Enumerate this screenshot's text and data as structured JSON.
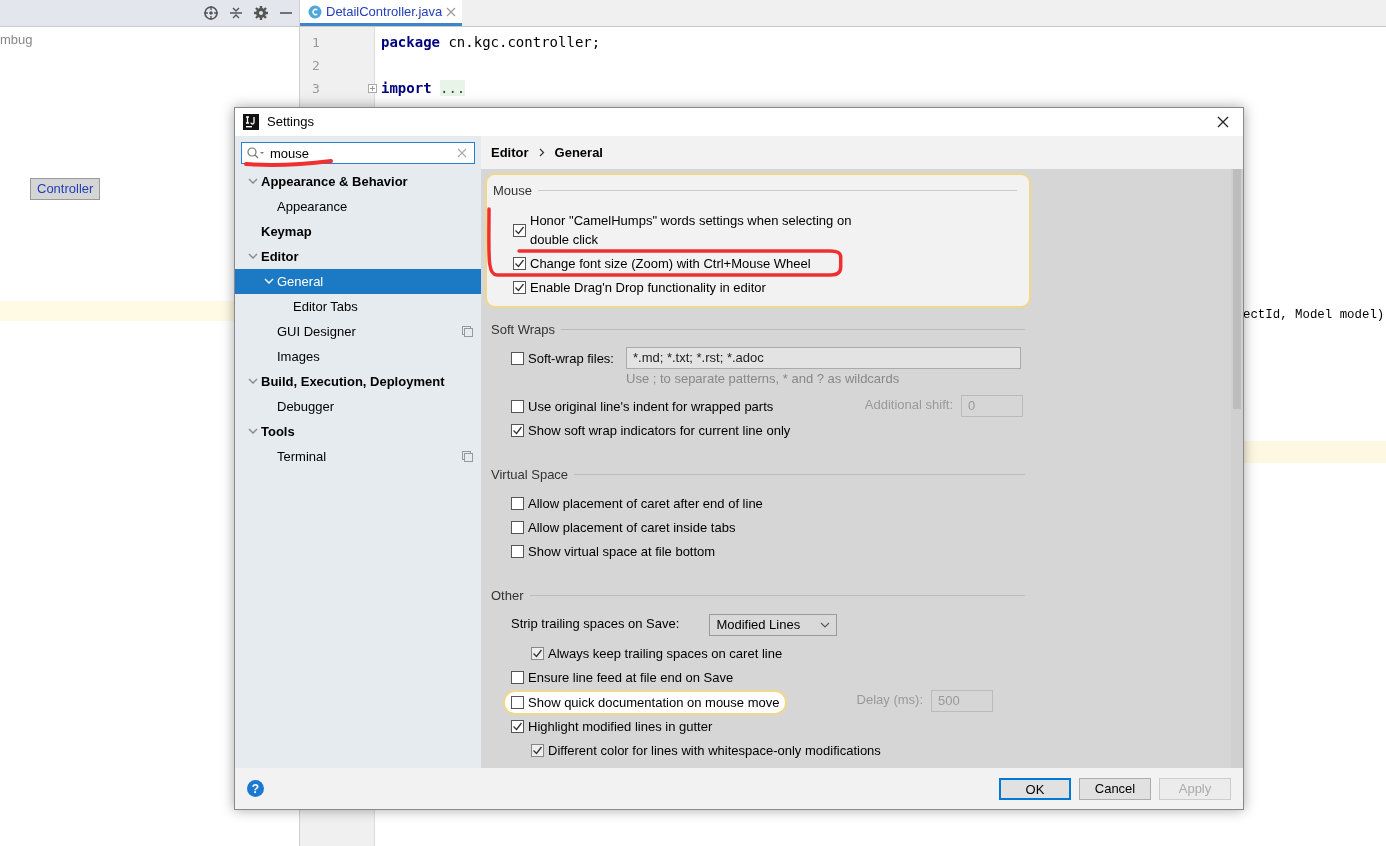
{
  "ide": {
    "project_tree": [
      {
        "label": "mbug",
        "kind": "muted",
        "selected": false
      },
      {
        "label": "Controller",
        "kind": "class",
        "selected": true
      }
    ],
    "editor_tab": {
      "label": "DetailController.java",
      "selected": true
    },
    "code": [
      {
        "number": "1",
        "keyword": "package",
        "rest": " cn.kgc.controller;"
      },
      {
        "number": "2"
      },
      {
        "number": "3",
        "keyword": "import",
        "rest": " ...",
        "folded": true
      }
    ],
    "code_fragment": "ectId, Model model)"
  },
  "dialog": {
    "title": "Settings",
    "search": {
      "value": "mouse"
    },
    "tree": [
      {
        "label": "Appearance & Behavior",
        "bold": true,
        "expanded": true,
        "selected": false,
        "children": [
          {
            "label": "Appearance",
            "bold": false,
            "selected": false
          }
        ]
      },
      {
        "label": "Keymap",
        "bold": true,
        "selected": false
      },
      {
        "label": "Editor",
        "bold": true,
        "expanded": true,
        "selected": false,
        "children": [
          {
            "label": "General",
            "bold": false,
            "expanded": true,
            "selected": true,
            "children": [
              {
                "label": "Editor Tabs",
                "bold": false,
                "selected": false
              }
            ]
          },
          {
            "label": "GUI Designer",
            "bold": false,
            "selected": false,
            "project_level": true
          },
          {
            "label": "Images",
            "bold": false,
            "selected": false
          }
        ]
      },
      {
        "label": "Build, Execution, Deployment",
        "bold": true,
        "expanded": true,
        "selected": false,
        "children": [
          {
            "label": "Debugger",
            "bold": false,
            "selected": false
          }
        ]
      },
      {
        "label": "Tools",
        "bold": true,
        "expanded": true,
        "selected": false,
        "children": [
          {
            "label": "Terminal",
            "bold": false,
            "selected": false,
            "project_level": true
          }
        ]
      }
    ],
    "breadcrumb": [
      "Editor",
      "General"
    ],
    "sections": [
      {
        "title": "Mouse",
        "highlighted": true,
        "options": [
          {
            "kind": "checkbox",
            "label": "Honor \"CamelHumps\" words settings when selecting on double click",
            "checked": true
          },
          {
            "kind": "checkbox",
            "label": "Change font size (Zoom) with Ctrl+Mouse Wheel",
            "checked": true
          },
          {
            "kind": "checkbox",
            "label": "Enable Drag'n Drop functionality in editor",
            "checked": true
          }
        ]
      },
      {
        "title": "Soft Wraps",
        "highlighted": false,
        "options": [
          {
            "kind": "checkbox",
            "label": "Soft-wrap files:",
            "checked": false,
            "field": {
              "value": "*.md; *.txt; *.rst; *.adoc",
              "disabled": false,
              "wide": true
            },
            "hint": "Use ; to separate patterns, * and ? as wildcards"
          },
          {
            "kind": "checkbox",
            "label": "Use original line's indent for wrapped parts",
            "checked": false,
            "field": {
              "label": "Additional shift:",
              "value": "0",
              "disabled": true
            }
          },
          {
            "kind": "checkbox",
            "label": "Show soft wrap indicators for current line only",
            "checked": true
          }
        ]
      },
      {
        "title": "Virtual Space",
        "highlighted": false,
        "options": [
          {
            "kind": "checkbox",
            "label": "Allow placement of caret after end of line",
            "checked": false
          },
          {
            "kind": "checkbox",
            "label": "Allow placement of caret inside tabs",
            "checked": false
          },
          {
            "kind": "checkbox",
            "label": "Show virtual space at file bottom",
            "checked": false
          }
        ]
      },
      {
        "title": "Other",
        "highlighted": false,
        "options": [
          {
            "kind": "select",
            "label": "Strip trailing spaces on Save:",
            "value": "Modified Lines",
            "children": [
              {
                "kind": "checkbox",
                "label": "Always keep trailing spaces on caret line",
                "checked": true
              }
            ]
          },
          {
            "kind": "checkbox",
            "label": "Ensure line feed at file end on Save",
            "checked": false
          },
          {
            "kind": "checkbox",
            "label": "Show quick documentation on mouse move",
            "checked": false,
            "highlighted": true,
            "field": {
              "label": "Delay (ms):",
              "value": "500",
              "disabled": true
            }
          },
          {
            "kind": "checkbox",
            "label": "Highlight modified lines in gutter",
            "checked": true,
            "children": [
              {
                "kind": "checkbox",
                "label": "Different color for lines with whitespace-only modifications",
                "checked": true
              }
            ]
          }
        ]
      }
    ],
    "help": "?",
    "buttons": [
      {
        "label": "OK",
        "default": true,
        "disabled": false
      },
      {
        "label": "Cancel",
        "default": false,
        "disabled": false
      },
      {
        "label": "Apply",
        "default": false,
        "disabled": true
      }
    ]
  }
}
